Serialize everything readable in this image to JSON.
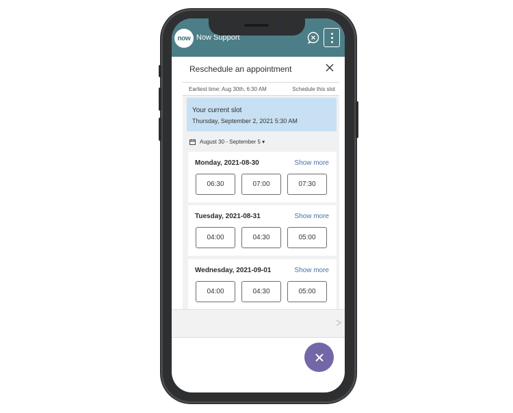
{
  "app": {
    "logo_text": "now",
    "title": "Now Support"
  },
  "panel": {
    "title": "Reschedule an appointment",
    "earliest_time": "Earliest time: Aug 30th, 6:30 AM",
    "schedule_this_slot": "Schedule this slot",
    "current_slot": {
      "label": "Your current slot",
      "value": "Thursday, September 2, 2021 5:30 AM"
    },
    "week_range": "August 30 - September 5 ▾",
    "show_more_label": "Show more",
    "days": [
      {
        "title": "Monday, 2021-08-30",
        "slots": [
          "06:30",
          "07:00",
          "07:30"
        ]
      },
      {
        "title": "Tuesday, 2021-08-31",
        "slots": [
          "04:00",
          "04:30",
          "05:00"
        ]
      },
      {
        "title": "Wednesday, 2021-09-01",
        "slots": [
          "04:00",
          "04:30",
          "05:00"
        ]
      }
    ]
  },
  "colors": {
    "header": "#4c7e87",
    "current_slot_bg": "#c7e0f3",
    "fab": "#7367a8",
    "link": "#4a6fa5"
  },
  "icons": [
    "chat-close-icon",
    "more-vertical-icon",
    "close-icon",
    "calendar-icon",
    "send-icon",
    "close-fab-icon"
  ]
}
